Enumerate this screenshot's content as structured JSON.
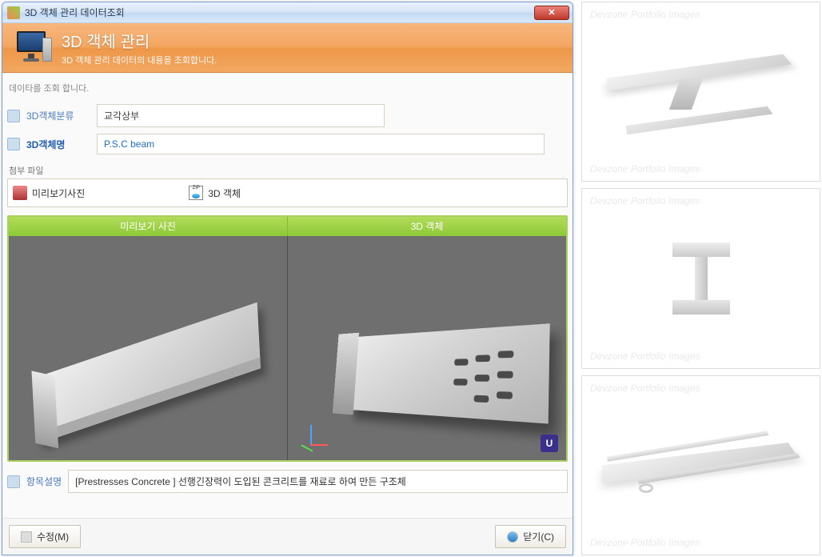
{
  "window": {
    "title": "3D 객체 관리 데이터조회"
  },
  "banner": {
    "title": "3D 객체 관리",
    "subtitle": "3D 객체 관리 데이터의 내용을 조회합니다."
  },
  "content": {
    "subtitle": "데이타를 조회 합니다."
  },
  "form": {
    "category_label": "3D객체분류",
    "category_value": "교각상부",
    "name_label": "3D객체명",
    "name_value": "P.S.C beam"
  },
  "attachments": {
    "section_label": "첨부 파일",
    "preview_photo": "미리보기사진",
    "object": "3D 객체"
  },
  "preview": {
    "tab_photo": "미리보기 사진",
    "tab_object": "3D 객체",
    "u": "U"
  },
  "description": {
    "label": "항목설명",
    "value": "[Prestresses Concrete ] 선행긴장력이 도입된 콘크리트를 재료로 하여 만든 구조체"
  },
  "buttons": {
    "edit": "수정(M)",
    "close": "닫기(C)"
  },
  "watermark": "Devzone Portfolio Images"
}
